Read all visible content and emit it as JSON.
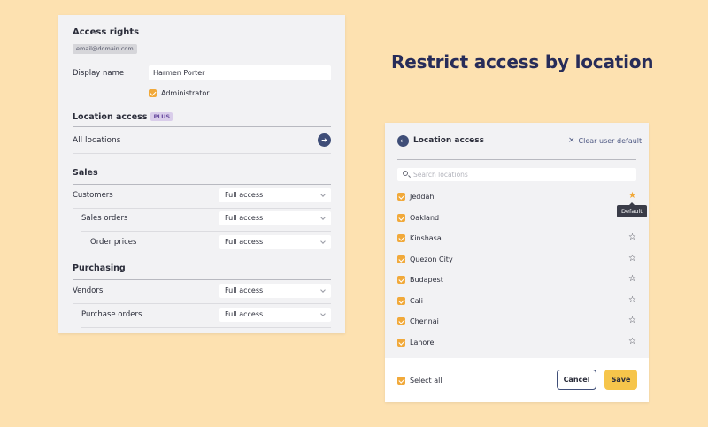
{
  "access_rights": {
    "title": "Access rights",
    "email": "email@domain.com",
    "display_name_label": "Display name",
    "display_name_value": "Harmen Porter",
    "administrator_label": "Administrator",
    "administrator_checked": true,
    "location_access_title": "Location access",
    "plus_badge": "PLUS",
    "all_locations": "All locations",
    "sales_title": "Sales",
    "purchasing_title": "Purchasing",
    "rows": [
      {
        "label": "Customers",
        "value": "Full access"
      },
      {
        "label": "Sales orders",
        "value": "Full access"
      },
      {
        "label": "Order prices",
        "value": "Full access"
      },
      {
        "label": "Vendors",
        "value": "Full access"
      },
      {
        "label": "Purchase orders",
        "value": "Full access"
      }
    ]
  },
  "headline": "Restrict access by location",
  "location_panel": {
    "title": "Location access",
    "clear_default": "Clear user default",
    "search_placeholder": "Search locations",
    "tooltip": "Default",
    "locations": [
      {
        "name": "Jeddah",
        "checked": true,
        "default": true
      },
      {
        "name": "Oakland",
        "checked": true,
        "default": false
      },
      {
        "name": "Kinshasa",
        "checked": true,
        "default": false
      },
      {
        "name": "Quezon City",
        "checked": true,
        "default": false
      },
      {
        "name": "Budapest",
        "checked": true,
        "default": false
      },
      {
        "name": "Cali",
        "checked": true,
        "default": false
      },
      {
        "name": "Chennai",
        "checked": true,
        "default": false
      },
      {
        "name": "Lahore",
        "checked": true,
        "default": false
      }
    ],
    "select_all": "Select all",
    "cancel": "Cancel",
    "save": "Save"
  },
  "colors": {
    "background": "#fde1b0",
    "accent_orange": "#f1a93a",
    "navy": "#3f4e78",
    "save_yellow": "#f6c54b"
  }
}
